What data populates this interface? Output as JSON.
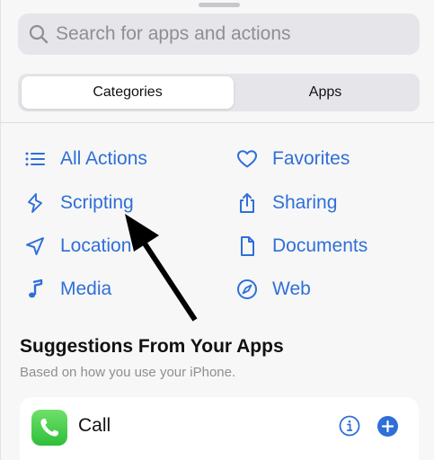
{
  "search": {
    "placeholder": "Search for apps and actions",
    "icon": "magnifying-glass"
  },
  "segmented_control": {
    "tabs": [
      {
        "label": "Categories",
        "selected": true
      },
      {
        "label": "Apps",
        "selected": false
      }
    ]
  },
  "categories": [
    {
      "label": "All Actions",
      "icon": "list-bullet"
    },
    {
      "label": "Favorites",
      "icon": "heart"
    },
    {
      "label": "Scripting",
      "icon": "scripting-curl"
    },
    {
      "label": "Sharing",
      "icon": "square-and-arrow-up"
    },
    {
      "label": "Location",
      "icon": "location-arrow"
    },
    {
      "label": "Documents",
      "icon": "doc"
    },
    {
      "label": "Media",
      "icon": "music-note"
    },
    {
      "label": "Web",
      "icon": "safari-compass"
    }
  ],
  "suggestions": {
    "title": "Suggestions From Your Apps",
    "subtitle": "Based on how you use your iPhone.",
    "items": [
      {
        "label": "Call",
        "app_icon": "phone-green"
      }
    ]
  },
  "colors": {
    "accent": "#2f6fd8",
    "background": "#f7f7f7",
    "phone_green": "#34c759"
  }
}
